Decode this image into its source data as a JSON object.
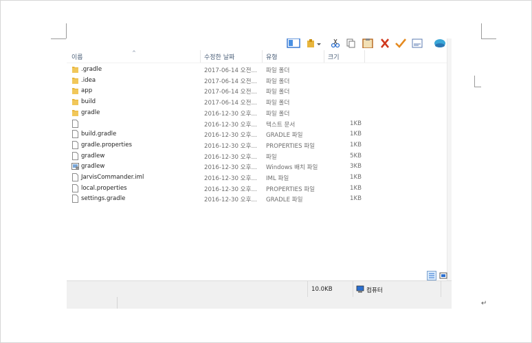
{
  "header": {
    "col_name": "이름",
    "col_modified": "수정한 날짜",
    "col_type": "유형",
    "col_size": "크기"
  },
  "files": [
    {
      "name": ".gradle",
      "date": "2017-06-14 오전...",
      "type": "파일 폴더",
      "size": "",
      "icon": "folder-icon"
    },
    {
      "name": ".idea",
      "date": "2017-06-14 오전...",
      "type": "파일 폴더",
      "size": "",
      "icon": "folder-icon"
    },
    {
      "name": "app",
      "date": "2017-06-14 오전...",
      "type": "파일 폴더",
      "size": "",
      "icon": "folder-icon"
    },
    {
      "name": "build",
      "date": "2017-06-14 오전...",
      "type": "파일 폴더",
      "size": "",
      "icon": "folder-icon"
    },
    {
      "name": "gradle",
      "date": "2016-12-30 오후...",
      "type": "파일 폴더",
      "size": "",
      "icon": "folder-icon"
    },
    {
      "name": "",
      "date": "2016-12-30 오후...",
      "type": "텍스트 문서",
      "size": "1KB",
      "icon": "text-file-icon"
    },
    {
      "name": "build.gradle",
      "date": "2016-12-30 오후...",
      "type": "GRADLE 파일",
      "size": "1KB",
      "icon": "file-icon"
    },
    {
      "name": "gradle.properties",
      "date": "2016-12-30 오후...",
      "type": "PROPERTIES 파일",
      "size": "1KB",
      "icon": "file-icon"
    },
    {
      "name": "gradlew",
      "date": "2016-12-30 오후...",
      "type": "파일",
      "size": "5KB",
      "icon": "file-icon"
    },
    {
      "name": "gradlew",
      "date": "2016-12-30 오후...",
      "type": "Windows 배치 파일",
      "size": "3KB",
      "icon": "batch-file-icon"
    },
    {
      "name": "JarvisCommander.iml",
      "date": "2016-12-30 오후...",
      "type": "IML 파일",
      "size": "1KB",
      "icon": "file-icon"
    },
    {
      "name": "local.properties",
      "date": "2016-12-30 오후...",
      "type": "PROPERTIES 파일",
      "size": "1KB",
      "icon": "file-icon"
    },
    {
      "name": "settings.gradle",
      "date": "2016-12-30 오후...",
      "type": "GRADLE 파일",
      "size": "1KB",
      "icon": "file-icon"
    }
  ],
  "status": {
    "total_size": "10.0KB",
    "location": "컴퓨터"
  },
  "colors": {
    "folder": "#e8b53c",
    "header_text": "#4c607a",
    "status_bg": "#f0f0f0"
  }
}
